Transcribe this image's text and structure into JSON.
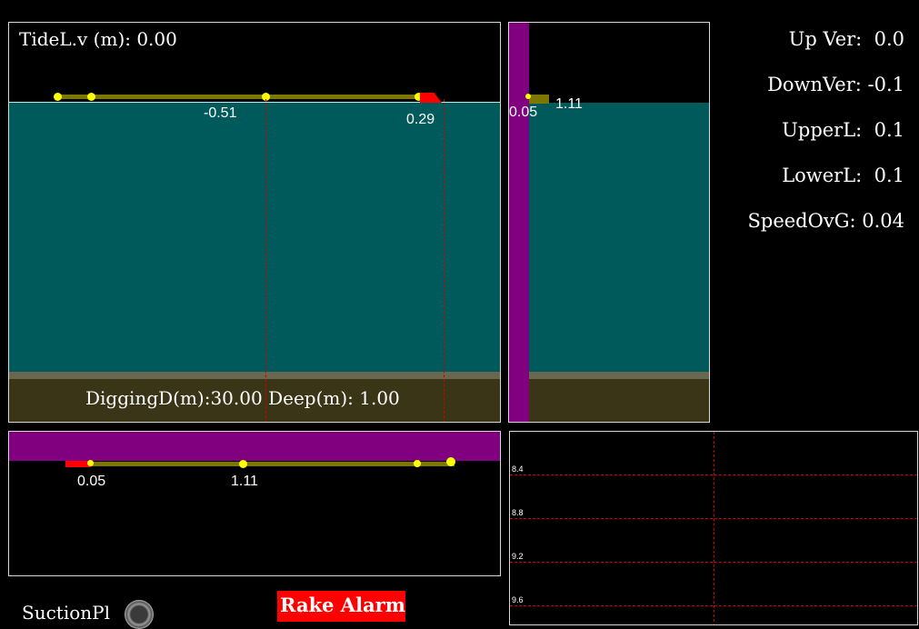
{
  "side_view": {
    "tide_label": "TideL.v (m): 0.00",
    "marker_left": "-0.51",
    "marker_right": "0.29",
    "bottom_label": "DiggingD(m):30.00 Deep(m): 1.00"
  },
  "front_view": {
    "marker_a": "0.05",
    "marker_b": "1.11"
  },
  "top_view": {
    "marker_a": "0.05",
    "marker_b": "1.11"
  },
  "stats": {
    "up_ver": "Up Ver:  0.0",
    "down_ver": "DownVer: -0.1",
    "upper_l": "UpperL:  0.1",
    "lower_l": "LowerL:  0.1",
    "speed_ovg": "SpeedOvG: 0.04"
  },
  "trend_chart": {
    "y_ticks": [
      "8.4",
      "8.8",
      "9.2",
      "9.6"
    ]
  },
  "footer": {
    "suction_label": "SuctionPl",
    "rake_alarm": "Rake Alarm"
  },
  "colors": {
    "water": "#005a5c",
    "soil": "#3b3518",
    "hull": "#800080",
    "pipe": "#7d7700",
    "joint": "#ffff00",
    "alarm": "#ff0000"
  },
  "icons": [
    "knob-icon"
  ]
}
